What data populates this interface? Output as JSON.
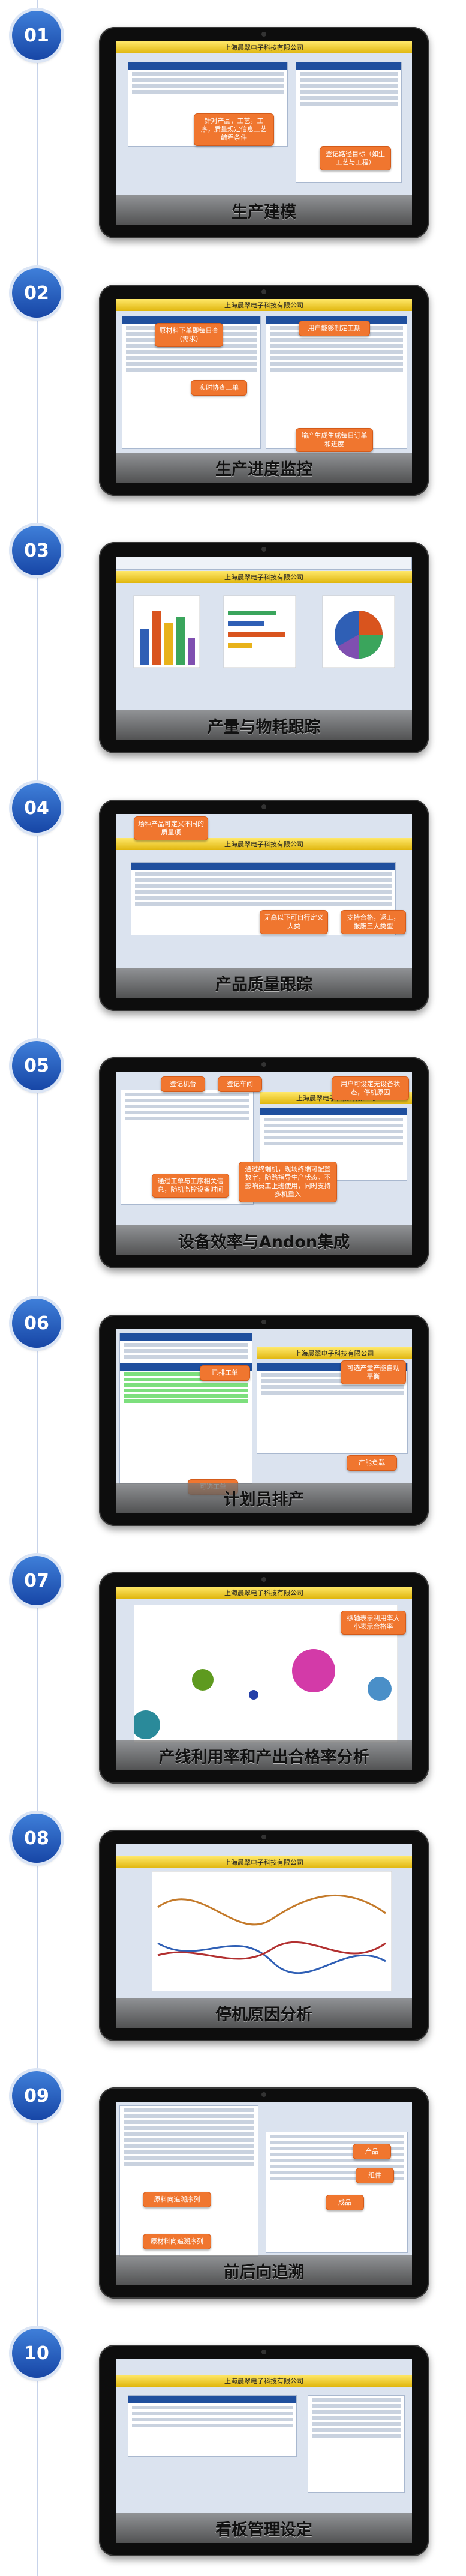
{
  "items": [
    {
      "number": "01",
      "caption": "生产建模",
      "app_title": "上海晨翠电子科技有限公司",
      "callouts": [
        "针对产品，工艺，工序，质量规定信息工艺编程条件",
        "登记路径目标（如生工艺与工程）"
      ]
    },
    {
      "number": "02",
      "caption": "生产进度监控",
      "app_title": "上海晨翠电子科技有限公司",
      "callouts": [
        "原材料下单即每日查（需求）",
        "用户能够制定工期",
        "实时协查工单",
        "输产生成生成每日订单和进度"
      ]
    },
    {
      "number": "03",
      "caption": "产量与物耗跟踪",
      "app_title": "上海晨翠电子科技有限公司",
      "callouts": []
    },
    {
      "number": "04",
      "caption": "产品质量跟踪",
      "app_title": "上海晨翠电子科技有限公司",
      "callouts": [
        "场种产品可定义不同的质量项",
        "无高以下可自行定义大类",
        "支持合格，返工，报废三大类型"
      ]
    },
    {
      "number": "05",
      "caption": "设备效率与Andon集成",
      "app_title": "上海晨翠电子科技有限公司",
      "callouts": [
        "登记机台",
        "登记车间",
        "用户可设定无设备状态，停机原因",
        "通过工单与工序相关信息，随机监控设备时间",
        "通过终端机，现场终端可配置数字，随路指导生产状态。不影响员工上班使用，同时支持多机重入"
      ]
    },
    {
      "number": "06",
      "caption": "计划员排产",
      "app_title": "上海晨翠电子科技有限公司",
      "callouts": [
        "已排工单",
        "可选产量产能自动平衡",
        "产能负载",
        "可选工单"
      ]
    },
    {
      "number": "07",
      "caption": "产线利用率和产出合格率分析",
      "app_title": "上海晨翠电子科技有限公司",
      "callouts": [
        "纵轴表示利用率大小表示合格率"
      ]
    },
    {
      "number": "08",
      "caption": "停机原因分析",
      "app_title": "上海晨翠电子科技有限公司",
      "callouts": []
    },
    {
      "number": "09",
      "caption": "前后向追溯",
      "app_title": "",
      "callouts": [
        "产品",
        "组件",
        "成品",
        "原料向追溯序列",
        "原材料向追溯序列"
      ]
    },
    {
      "number": "10",
      "caption": "看板管理设定",
      "app_title": "上海晨翠电子科技有限公司",
      "callouts": []
    }
  ],
  "colors": {
    "accent": "#1f4f9e",
    "callout": "#f0762f",
    "badge": "#2a63c8"
  }
}
